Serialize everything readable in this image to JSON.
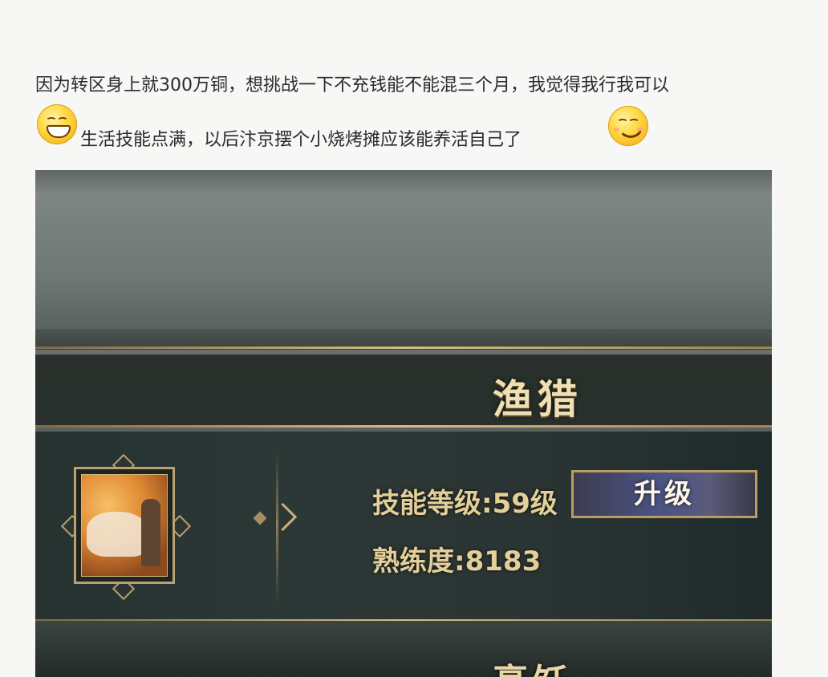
{
  "post": {
    "line1": "因为转区身上就300万铜，想挑战一下不充钱能不能混三个月，我觉得我行我可以",
    "line2": "生活技能点满，以后汴京摆个小烧烤摊应该能养活自己了"
  },
  "emojis": [
    "grin-emoji-icon",
    "smile-emoji-icon"
  ],
  "game_panel": {
    "skill_title": "渔猎",
    "level_label": "技能等级:59级",
    "proficiency_label": "熟练度:8183",
    "upgrade_button": "升级",
    "next_title": "烹饪"
  },
  "colors": {
    "gold_text": "#e4cf98",
    "button_blue": "#4a5383",
    "frame_gold": "#b8a172"
  }
}
